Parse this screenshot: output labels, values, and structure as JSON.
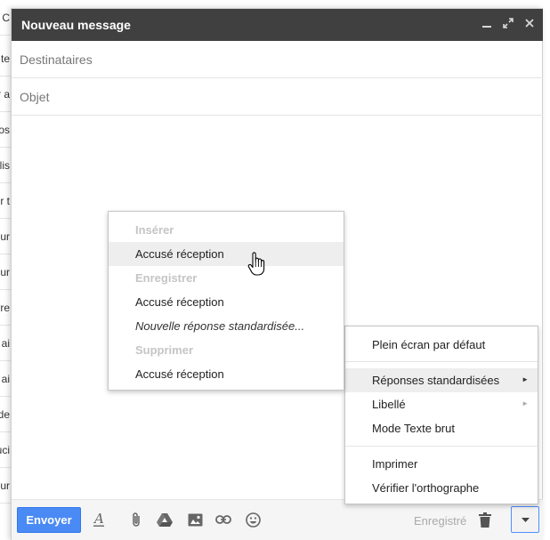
{
  "background_list": {
    "rows": [
      "y C",
      "te",
      "r a",
      "os",
      "olis",
      "r t",
      "ur",
      "ur",
      "vre",
      "ai",
      "ai",
      "de",
      "uci",
      "cur"
    ]
  },
  "compose": {
    "title": "Nouveau message",
    "window_controls": [
      "minimize-icon",
      "expand-icon",
      "close-icon"
    ],
    "to_placeholder": "Destinataires",
    "subject_placeholder": "Objet"
  },
  "toolbar": {
    "send_label": "Envoyer",
    "icons": [
      "text-format-icon",
      "attach-icon",
      "drive-icon",
      "photo-icon",
      "link-icon",
      "emoji-icon"
    ],
    "saved_label": "Enregistré",
    "trash_icon": "trash-icon",
    "more_icon": "chevron-down-icon"
  },
  "more_menu": {
    "fullscreen_default": "Plein écran par défaut",
    "canned_responses": "Réponses standardisées",
    "label": "Libellé",
    "plain_text": "Mode Texte brut",
    "print": "Imprimer",
    "spellcheck": "Vérifier l'orthographe"
  },
  "canned_menu": {
    "insert_header": "Insérer",
    "insert_item": "Accusé réception",
    "save_header": "Enregistrer",
    "save_item": "Accusé réception",
    "new_response": "Nouvelle réponse standardisée...",
    "delete_header": "Supprimer",
    "delete_item": "Accusé réception"
  },
  "colors": {
    "titlebar": "#404040",
    "send_button": "#4a8af4",
    "hover_row": "#eeeeee",
    "menu_header": "#c5c5c5"
  }
}
